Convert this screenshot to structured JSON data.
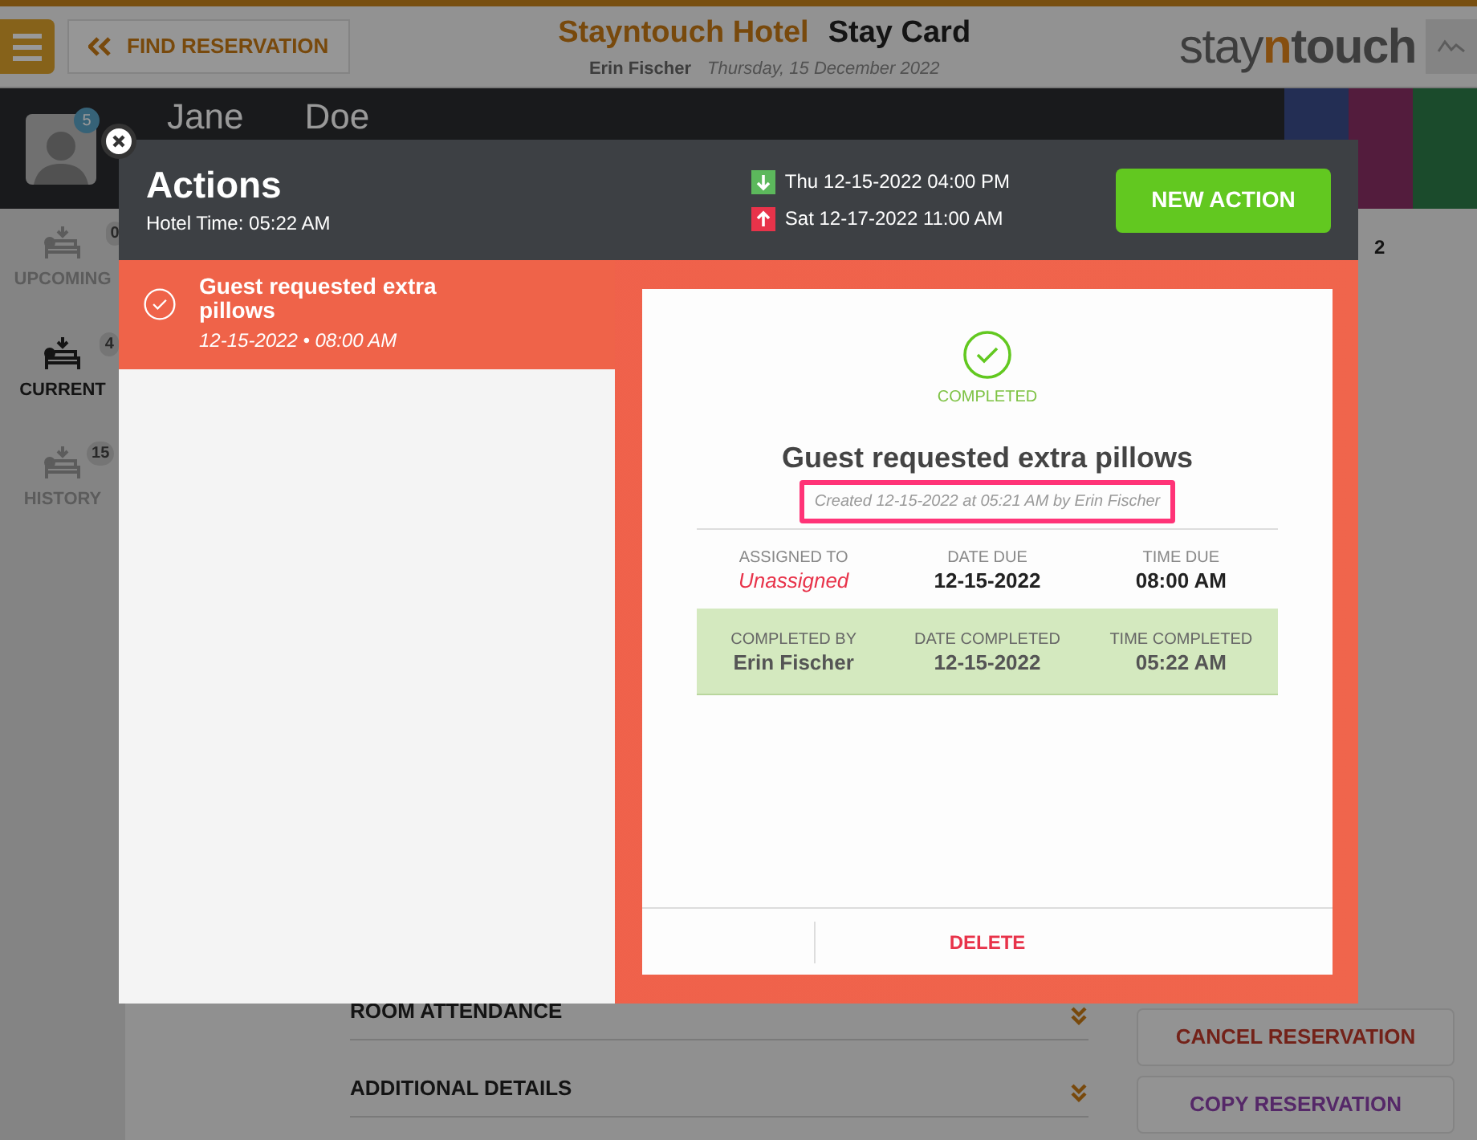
{
  "header": {
    "find_reservation": "FIND RESERVATION",
    "hotel": "Stayntouch Hotel",
    "page": "Stay Card",
    "user": "Erin Fischer",
    "date": "Thursday, 15 December 2022",
    "logo": {
      "prefix": "stay",
      "highlight": "n",
      "suffix": "touch"
    }
  },
  "guest": {
    "badge": "5",
    "first_name": "Jane",
    "last_name": "Doe"
  },
  "sidebar": {
    "items": [
      {
        "label": "UPCOMING",
        "count": "0",
        "selected": false
      },
      {
        "label": "CURRENT",
        "count": "4",
        "selected": true
      },
      {
        "label": "HISTORY",
        "count": "15",
        "selected": false
      }
    ]
  },
  "background": {
    "pager": "2",
    "sections": [
      "ROOM ATTENDANCE",
      "ADDITIONAL DETAILS"
    ],
    "buttons": [
      {
        "label": "CANCEL RESERVATION",
        "kind": "danger"
      },
      {
        "label": "COPY RESERVATION",
        "kind": "accent"
      }
    ]
  },
  "modal": {
    "title": "Actions",
    "hotel_time": "Hotel Time: 05:22 AM",
    "arrival": "Thu 12-15-2022 04:00 PM",
    "departure": "Sat 12-17-2022 11:00 AM",
    "new_action": "NEW ACTION",
    "actions": [
      {
        "title": "Guest requested extra pillows",
        "due": "12-15-2022 • 08:00 AM",
        "completed": true,
        "selected": true
      }
    ],
    "detail": {
      "status": "COMPLETED",
      "title": "Guest requested extra pillows",
      "created": "Created 12-15-2022 at 05:21 AM by Erin Fischer",
      "highlighted": true,
      "due_fields": [
        {
          "label": "ASSIGNED TO",
          "value": "Unassigned",
          "kind": "warning"
        },
        {
          "label": "DATE DUE",
          "value": "12-15-2022",
          "kind": "normal"
        },
        {
          "label": "TIME DUE",
          "value": "08:00 AM",
          "kind": "normal"
        }
      ],
      "completed_fields": [
        {
          "label": "COMPLETED BY",
          "value": "Erin Fischer"
        },
        {
          "label": "DATE COMPLETED",
          "value": "12-15-2022"
        },
        {
          "label": "TIME COMPLETED",
          "value": "05:22 AM"
        }
      ],
      "delete": "DELETE"
    }
  }
}
